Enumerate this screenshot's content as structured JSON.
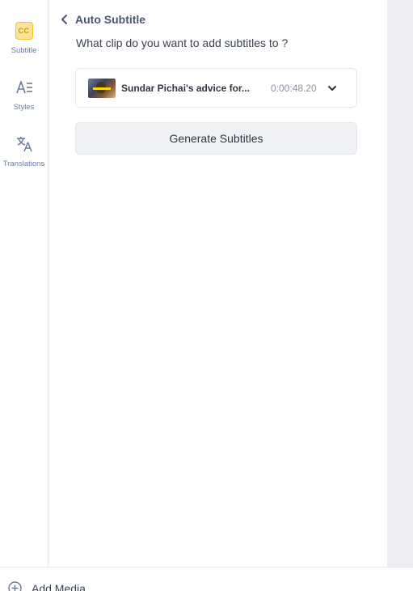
{
  "sidebar": {
    "items": [
      {
        "label": "Subtitle",
        "icon": "cc-icon",
        "active": true
      },
      {
        "label": "Styles",
        "icon": "styles-icon"
      },
      {
        "label": "Translations",
        "icon": "translate-icon"
      }
    ]
  },
  "panel": {
    "title": "Auto Subtitle",
    "question": "What clip do you want to add subtitles to ?",
    "clip": {
      "name": "Sundar Pichai's advice for...",
      "duration": "0:00:48.20"
    },
    "generate_label": "Generate Subtitles"
  },
  "bottom": {
    "add_media_label": "Add Media"
  },
  "colors": {
    "accent": "#f4c430",
    "accent_fill": "#fde39a",
    "icon": "#6b7a99",
    "button_bg": "#f1f2f5",
    "gutter": "#ecedf1"
  }
}
